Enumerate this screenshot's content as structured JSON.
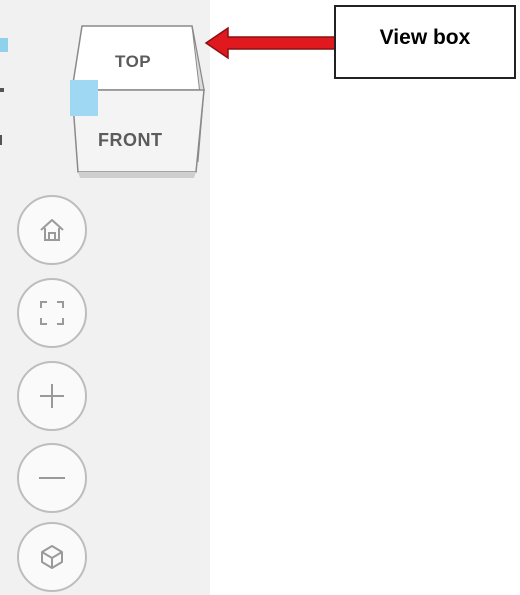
{
  "view_cube": {
    "top_label": "TOP",
    "front_label": "FRONT",
    "highlight_color": "#9ed8f2"
  },
  "nav_buttons": [
    {
      "name": "home-button",
      "icon": "home-icon"
    },
    {
      "name": "fit-to-view-button",
      "icon": "fit-frame-icon"
    },
    {
      "name": "zoom-in-button",
      "icon": "plus-icon"
    },
    {
      "name": "zoom-out-button",
      "icon": "minus-icon"
    },
    {
      "name": "orbit-button",
      "icon": "orbit-cube-icon"
    }
  ],
  "callout": {
    "label": "View box",
    "arrow_color": "#e0191f"
  }
}
